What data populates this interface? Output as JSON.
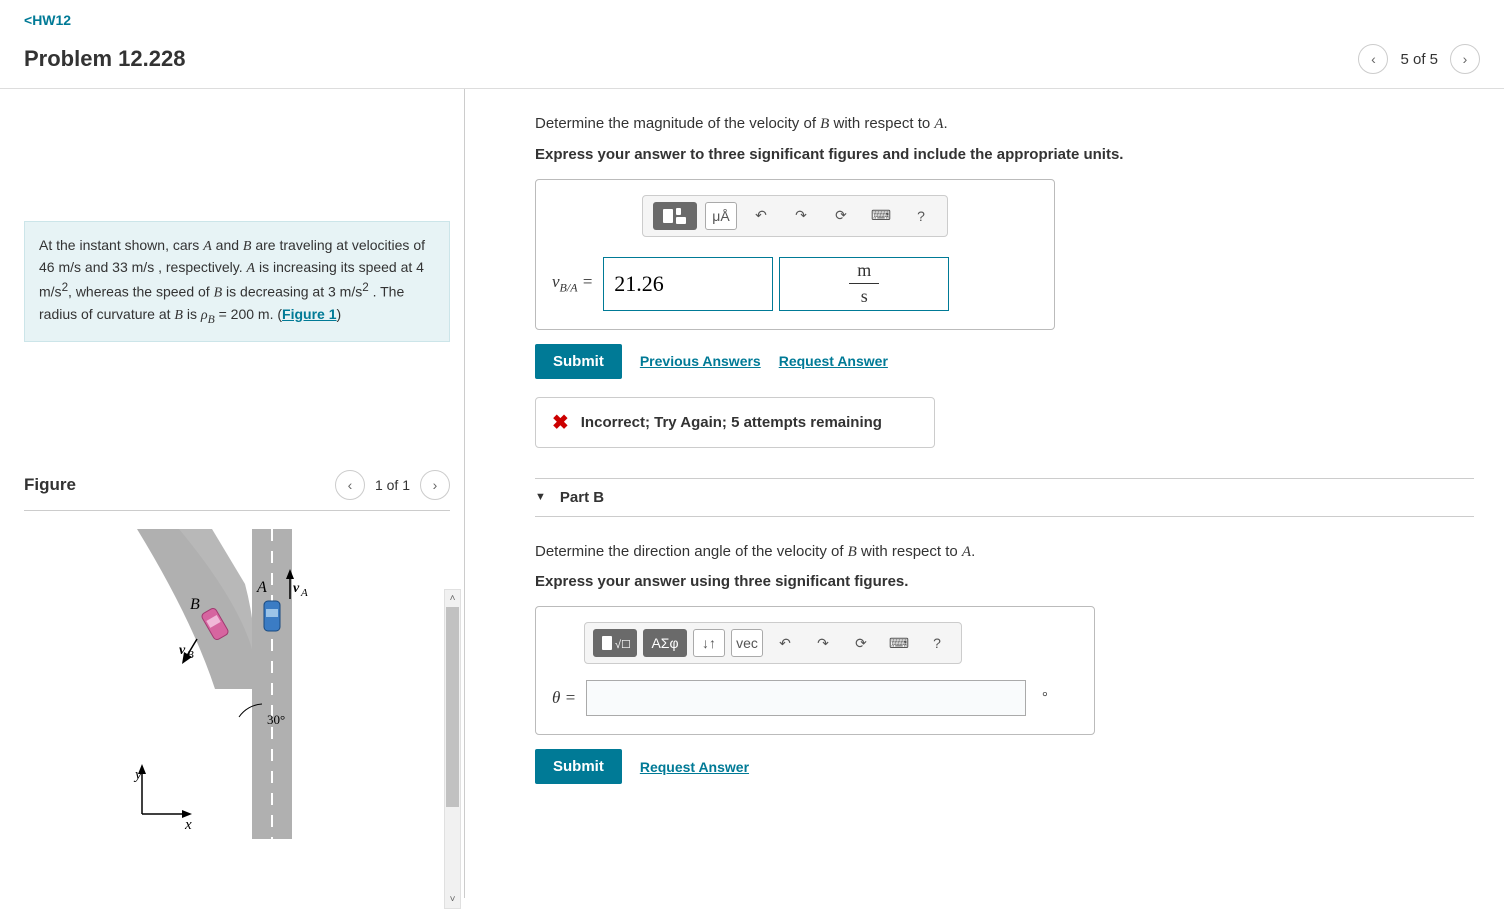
{
  "nav": {
    "back": "HW12",
    "title": "Problem 12.228",
    "pos": "5 of 5"
  },
  "problem": {
    "intro1": "At the instant shown, cars ",
    "A": "A",
    "and": " and ",
    "B": "B",
    "intro2": " are traveling at velocities of 46 ",
    "u1": "m/s",
    "intro3": " and 33 ",
    "u2": "m/s",
    "intro4": " , respectively. ",
    "intro5": " is increasing its speed at 4 ",
    "u3": "m/s",
    "intro6": ", whereas the speed of ",
    "intro7": " is decreasing at 3 ",
    "u4": "m/s",
    "intro8": " . The radius of curvature at ",
    "intro9": " is ",
    "rho": "ρ",
    "rhoSub": "B",
    "rhoVal": " = 200 ",
    "rhoUnit": "m",
    "dot": ". (",
    "figlink": "Figure 1",
    "close": ")"
  },
  "figure": {
    "title": "Figure",
    "pos": "1 of 1",
    "labels": {
      "A": "A",
      "B": "B",
      "vA": "vA",
      "vB": "vB",
      "ang": "30°",
      "x": "x",
      "y": "y"
    }
  },
  "partA": {
    "q": "Determine the magnitude of the velocity of ",
    "q2": " with respect to ",
    "q3": ".",
    "instr": "Express your answer to three significant figures and include the appropriate units.",
    "var": "v",
    "sub": "B/A",
    "eq": " = ",
    "value": "21.26",
    "unit_top": "m",
    "unit_bot": "s",
    "submit": "Submit",
    "prev": "Previous Answers",
    "req": "Request Answer",
    "feedback": "Incorrect; Try Again; 5 attempts remaining",
    "toolbar": {
      "mu": "μÅ",
      "help": "?"
    }
  },
  "partB": {
    "header": "Part B",
    "q": "Determine the direction angle of the velocity of ",
    "q2": " with respect to ",
    "q3": ".",
    "instr": "Express your answer using three significant figures.",
    "var": "θ",
    "eq": " = ",
    "unit": "°",
    "submit": "Submit",
    "req": "Request Answer",
    "toolbar": {
      "sig": "ΑΣφ",
      "vec": "vec",
      "help": "?"
    }
  }
}
